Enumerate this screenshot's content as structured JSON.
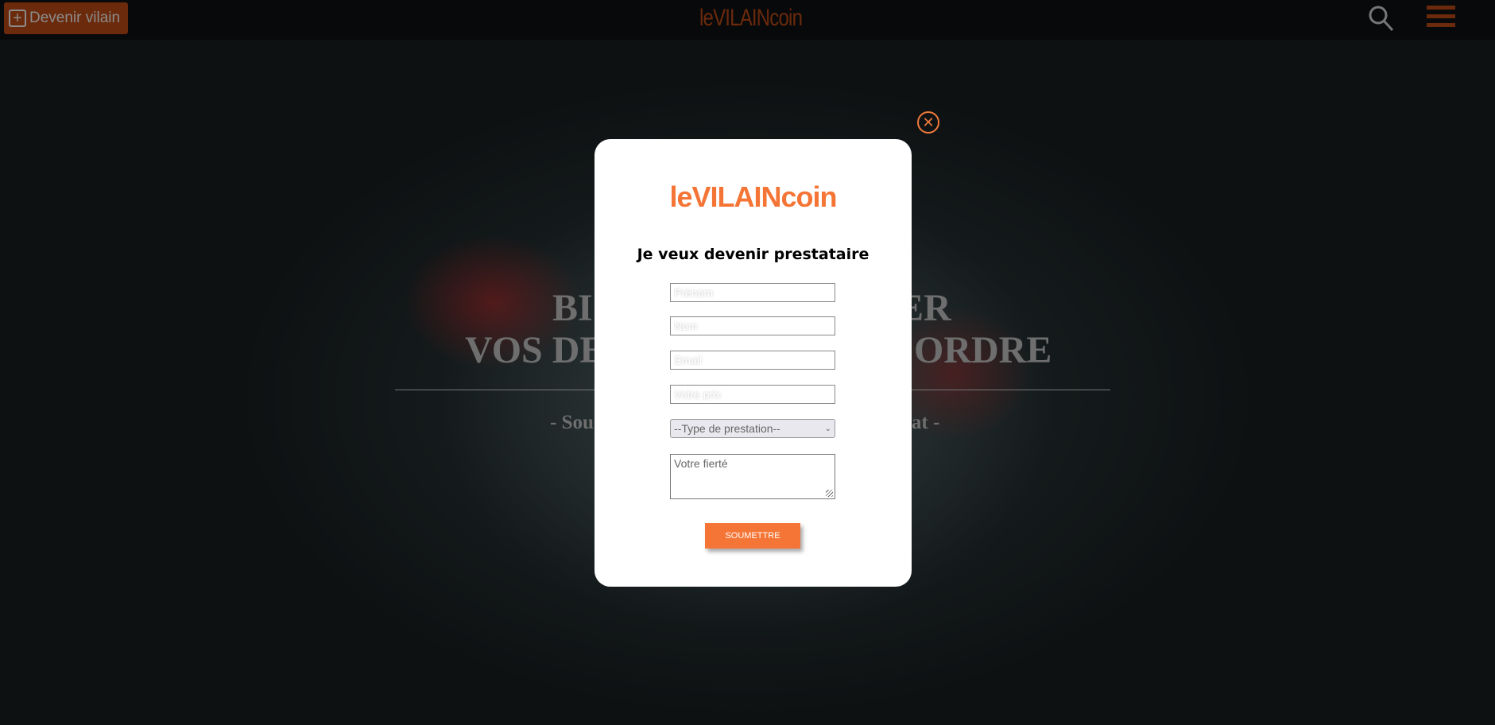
{
  "header": {
    "become_label": "Devenir vilain",
    "logo": "leVILAINcoin"
  },
  "hero": {
    "line1_left": "BI",
    "line1_right": "ER",
    "line2_left": "VOS DE",
    "line2_right": "ORDRE",
    "sub_left": "- Sou",
    "sub_right": "nat -"
  },
  "modal": {
    "logo": "leVILAINcoin",
    "title": "Je veux devenir prestataire",
    "fields": {
      "prenom": "Prénom",
      "nom": "Nom",
      "email": "Email",
      "prix": "Votre prix"
    },
    "select_value": "--Type de prestation--",
    "textarea_placeholder": "Votre fierté",
    "submit_label": "SOUMETTRE"
  },
  "colors": {
    "accent": "#f47535",
    "header_accent": "#6b2a0c"
  }
}
